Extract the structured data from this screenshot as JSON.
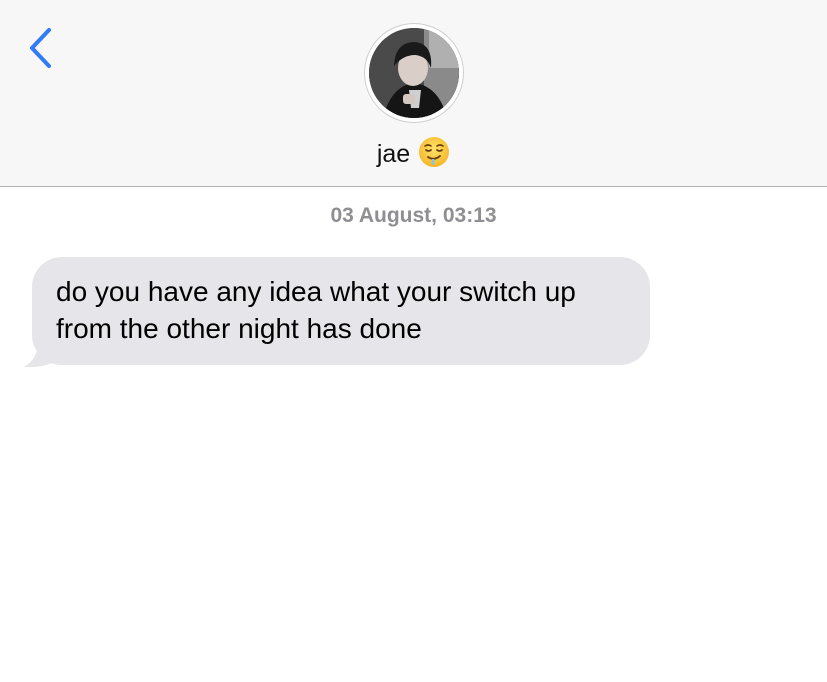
{
  "header": {
    "contact_name": "jae",
    "contact_emoji": "drooling-face-emoji",
    "avatar": "contact-avatar-photo"
  },
  "icons": {
    "back": "chevron-left-icon"
  },
  "colors": {
    "accent": "#2f7cf6",
    "header_bg": "#f7f7f7",
    "incoming_bubble": "#e5e5ea",
    "timestamp": "#8e8e93"
  },
  "conversation": {
    "timestamp": "03 August, 03:13",
    "messages": [
      {
        "direction": "incoming",
        "text": "do you have any idea what your switch up from the other night has done"
      }
    ]
  }
}
